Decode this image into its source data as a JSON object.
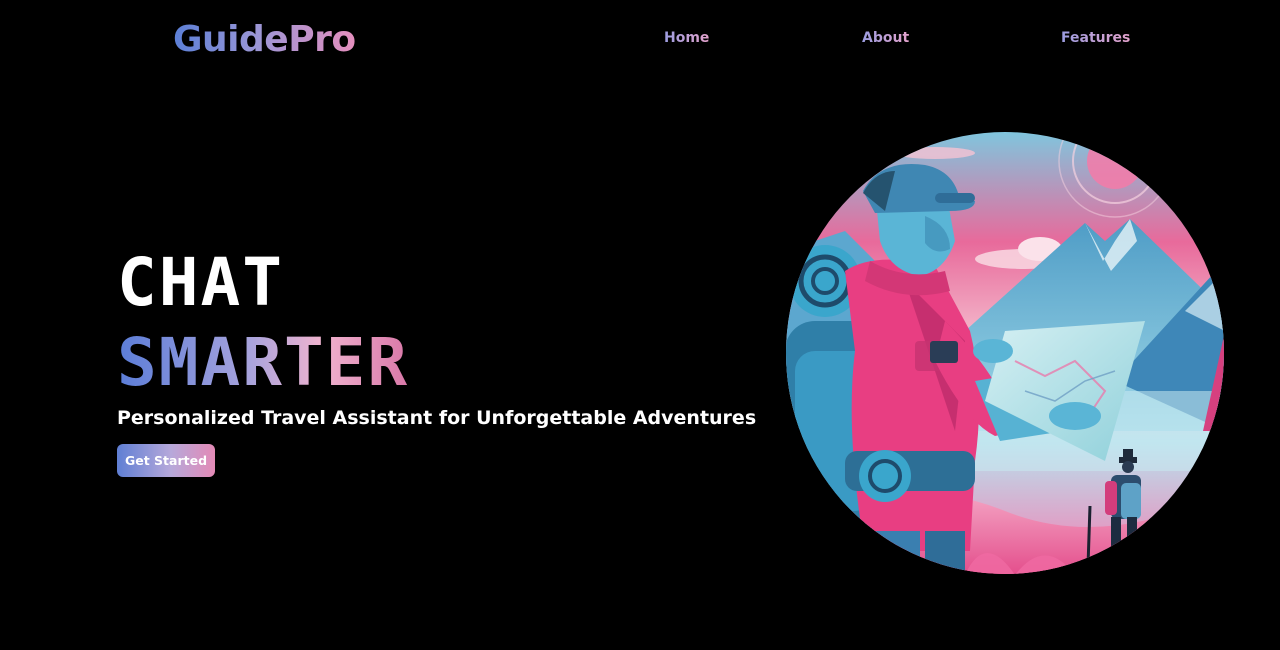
{
  "header": {
    "logo": "GuidePro",
    "nav": [
      {
        "label": "Home"
      },
      {
        "label": "About"
      },
      {
        "label": "Features"
      }
    ]
  },
  "hero": {
    "headline_line1": "CHAT",
    "headline_line2": "SMARTER",
    "tagline": "Personalized Travel Assistant for Unforgettable Adventures",
    "cta_label": "Get Started"
  },
  "colors": {
    "background": "#000000",
    "accent_blue": "#5b7fd6",
    "accent_pink": "#e58fbe"
  }
}
